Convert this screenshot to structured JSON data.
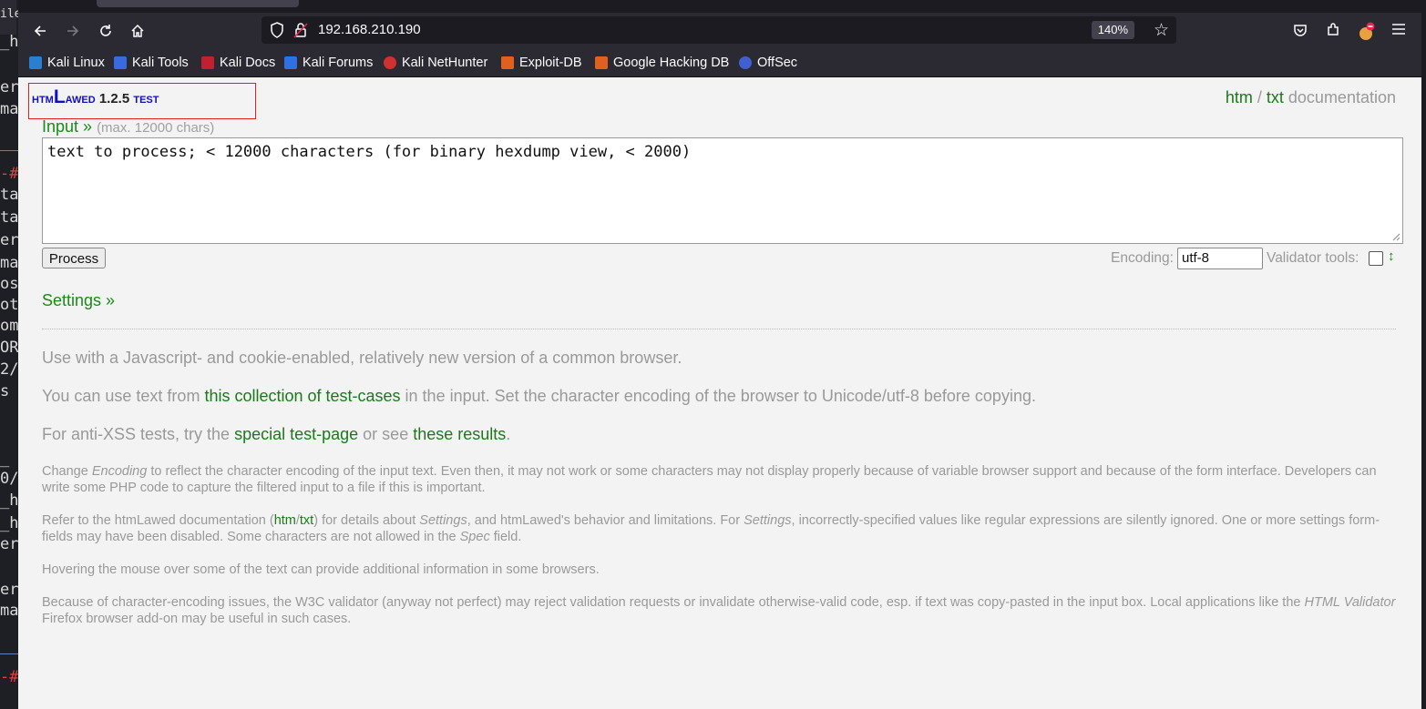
{
  "terminal": {
    "title_fragment": "ile",
    "lines": [
      "_h",
      "er",
      "ma",
      "-#",
      "ta",
      "ta",
      "er",
      "ma",
      "os",
      "ot",
      "om",
      "OR",
      "2/",
      " s",
      "_",
      "0/",
      "_h",
      "_h",
      "er",
      "er",
      "ma",
      "-#"
    ]
  },
  "browser": {
    "url": "192.168.210.190",
    "zoom": "140%",
    "bookmarks": [
      "Kali Linux",
      "Kali Tools",
      "Kali Docs",
      "Kali Forums",
      "Kali NetHunter",
      "Exploit-DB",
      "Google Hacking DB",
      "OffSec"
    ]
  },
  "page": {
    "logo": {
      "part1": "htm",
      "part2": "L",
      "part3": "awed",
      "version": "1.2.5",
      "suffix": "test"
    },
    "doc_links": {
      "htm": "htm",
      "sep": " / ",
      "txt": "txt",
      "documentation": " documentation"
    },
    "input_label": "Input »",
    "input_max": "(max. 12000 chars)",
    "textarea_value": "text to process; < 12000 characters (for binary hexdump view, < 2000)",
    "process_button": "Process",
    "encoding_label": "Encoding:",
    "encoding_value": "utf-8",
    "validator_label": "Validator tools:",
    "validator_arrow": "↕",
    "settings_link": "Settings »",
    "para1": "Use with a Javascript- and cookie-enabled, relatively new version of a common browser.",
    "para2": {
      "a": "You can use text from ",
      "link": "this collection of test-cases",
      "b": " in the input. Set the character encoding of the browser to Unicode/utf-8 before copying."
    },
    "para3": {
      "a": "For anti-XSS tests, try the ",
      "link1": "special test-page",
      "b": " or see ",
      "link2": "these results",
      "c": "."
    },
    "note1": {
      "a": "Change ",
      "em": "Encoding",
      "b": " to reflect the character encoding of the input text. Even then, it may not work or some characters may not display properly because of variable browser support and because of the form interface. Developers can write some PHP code to capture the filtered input to a file if this is important."
    },
    "note2": {
      "a": "Refer to the htmLawed documentation (",
      "htm": "htm",
      "slash": "/",
      "txt": "txt",
      "b": ") for details about ",
      "em1": "Settings",
      "c": ", and htmLawed's behavior and limitations. For ",
      "em2": "Settings",
      "d": ", incorrectly-specified values like regular expressions are silently ignored. One or more settings form-fields may have been disabled. Some characters are not allowed in the ",
      "em3": "Spec",
      "e": " field."
    },
    "note3": "Hovering the mouse over some of the text can provide additional information in some browsers.",
    "note4": {
      "a": "Because of character-encoding issues, the W3C validator (anyway not perfect) may reject validation requests or invalidate otherwise-valid code, esp. if text was copy-pasted in the input box. Local applications like the ",
      "em": "HTML Validator",
      "b": " Firefox browser add-on may be useful in such cases."
    }
  },
  "colors": {
    "link_green": "#1a7a1a",
    "logo_blue": "#1010c0",
    "muted_gray": "#999999",
    "toolbar": "#2b2a33"
  }
}
